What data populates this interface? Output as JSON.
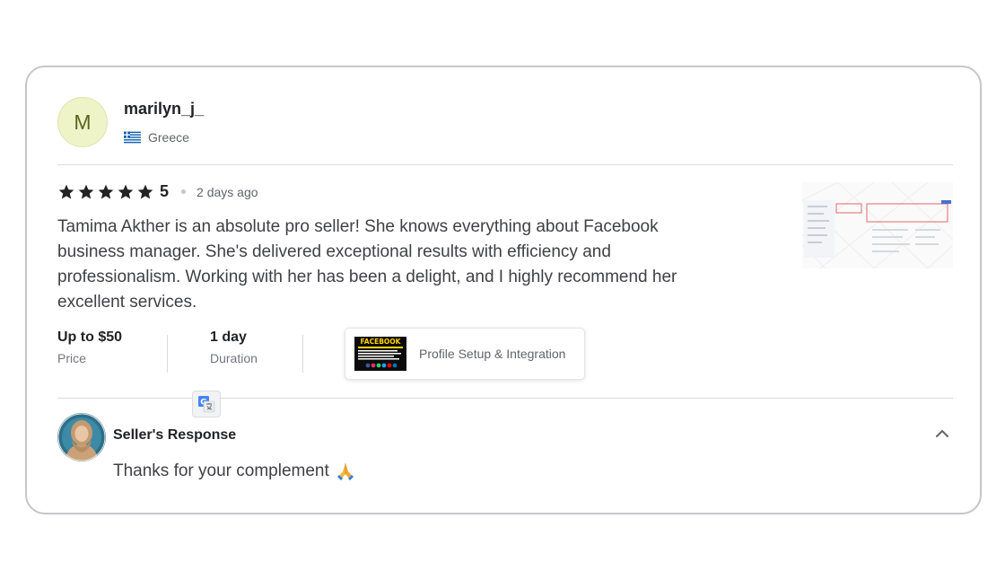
{
  "reviewer": {
    "avatar_letter": "M",
    "username": "marilyn_j_",
    "country": "Greece",
    "flag_icon": "greece-flag-icon"
  },
  "rating": {
    "stars": 5,
    "value": "5",
    "time_ago": "2 days ago"
  },
  "review": {
    "text": "Tamima Akther is an absolute pro seller! She knows everything about Facebook business manager. She's delivered exceptional results with efficiency and professionalism. Working with her has been a delight, and I highly recommend her excellent services."
  },
  "meta": {
    "price_value": "Up to $50",
    "price_label": "Price",
    "duration_value": "1 day",
    "duration_label": "Duration"
  },
  "gig": {
    "thumb_text": "FACEBOOK",
    "title": "Profile Setup & Integration"
  },
  "seller_response": {
    "title": "Seller's Response",
    "text": "Thanks for your complement",
    "emoji_icon": "folded-hands-icon"
  },
  "colors": {
    "accent_star": "#222325",
    "avatar_bg": "#eef3c8",
    "border": "#c5c6c9"
  }
}
